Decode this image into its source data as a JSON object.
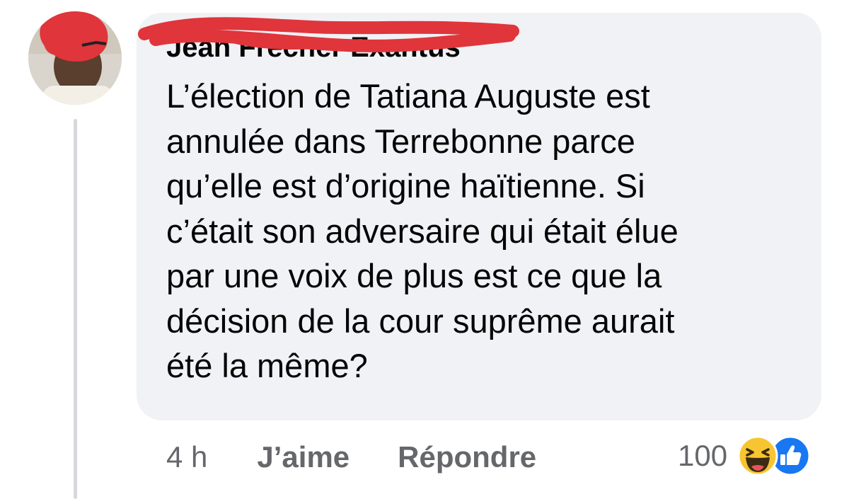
{
  "comment": {
    "author": "Jean Frecner Exantus",
    "lines": [
      "L’élection de Tatiana Auguste est",
      "annulée dans Terrebonne parce",
      "qu’elle est d’origine haïtienne. Si",
      "c’était son adversaire qui était élue",
      "par une voix de plus est ce que la",
      "décision de la cour suprême aurait",
      "été la même?"
    ],
    "time": "4 h",
    "like_label": "J’aime",
    "reply_label": "Répondre",
    "reaction_count": "100",
    "reaction_icons": [
      "haha-emoji-icon",
      "like-thumb-icon"
    ]
  },
  "colors": {
    "bubble": "#f0f2f5",
    "text": "#050505",
    "muted": "#65676b",
    "redaction": "#e0353b",
    "like_blue": "#1877f2"
  }
}
